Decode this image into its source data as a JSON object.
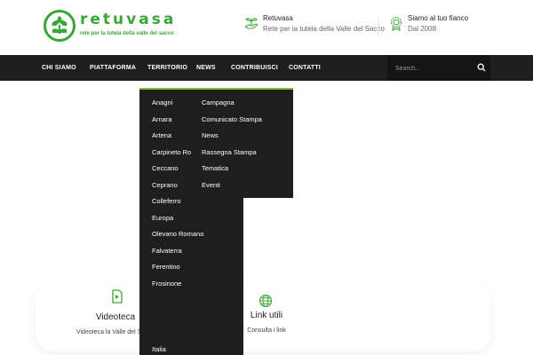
{
  "brand": {
    "name": "retuvasa",
    "tagline": "rete per la tutela della valle del sacco",
    "color": "#3aa637"
  },
  "header": {
    "info_1": {
      "title": "Retuvasa",
      "subtitle": "Rete per la tutela della Valle del Sacco",
      "icon": "plant-hand-icon"
    },
    "info_2": {
      "title": "Siamo al tuo fianco",
      "subtitle": "Dal 2008",
      "icon": "award-badge-icon"
    }
  },
  "nav": {
    "items": [
      "CHI SIAMO",
      "PIATTAFORMA",
      "TERRITORIO",
      "NEWS",
      "CONTRIBUISCI",
      "CONTATTI"
    ],
    "search_placeholder": "Search..."
  },
  "dropdown": {
    "territorio": [
      "Anagni",
      "Arnara",
      "Artena",
      "Carpineto Romano",
      "Ceccano",
      "Ceprano",
      "Colleferro",
      "Europa",
      "Olevano Romano",
      "Falvaterra",
      "Ferentino",
      "Frosinone"
    ],
    "news": [
      "Campagna",
      "Comunicato Stampa",
      "News",
      "Rassegna Stampa",
      "Tematica",
      "Eventi"
    ],
    "partial_bottom": "Italia",
    "accent_color": "#8bbd3f"
  },
  "cards": [
    {
      "title": "Videoteca",
      "subtitle": "Videoteca la Valle del Sacco",
      "icon": "video-file-icon"
    },
    {
      "title": "Link utili",
      "subtitle": "Consulta i link",
      "icon": "globe-icon"
    }
  ]
}
